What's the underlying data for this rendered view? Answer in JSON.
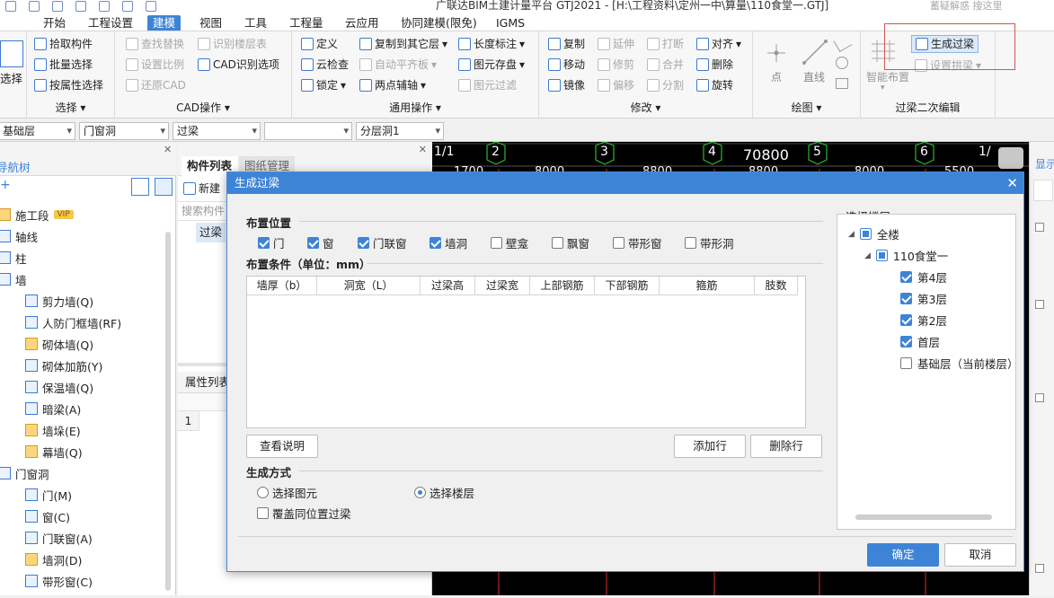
{
  "titlebar": {
    "title": "广联达BIM土建计量平台 GTJ2021 - [H:\\工程资料\\定州一中\\算量\\110食堂一.GTJ]",
    "search": "蓄疑解惑  搜这里"
  },
  "menu": [
    "开始",
    "工程设置",
    "建模",
    "视图",
    "工具",
    "工程量",
    "云应用",
    "协同建模(限免)",
    "IGMS"
  ],
  "ribbon": {
    "select": {
      "big": "选择",
      "label": "选择"
    },
    "pick": {
      "pick": "拾取构件",
      "batch": "批量选择",
      "byattr": "按属性选择"
    },
    "cad": {
      "find_replace": "查找替换",
      "set_scale": "设置比例",
      "restore_cad": "还原CAD",
      "identify_floor": "识别楼层表",
      "cad_options": "CAD识别选项",
      "label": "CAD操作"
    },
    "general": {
      "define": "定义",
      "cloud_check": "云检查",
      "lock": "锁定",
      "copy_other": "复制到其它层",
      "auto_flat": "自动平齐板",
      "two_point_axis": "两点辅轴",
      "length_mark": "长度标注",
      "elem_save": "图元存盘",
      "elem_filter": "图元过滤",
      "label": "通用操作"
    },
    "modify": {
      "copy": "复制",
      "move": "移动",
      "mirror": "镜像",
      "extend": "延伸",
      "trim": "修剪",
      "offset": "偏移",
      "break": "打断",
      "merge": "合并",
      "split": "分割",
      "align": "对齐",
      "delete": "删除",
      "rotate": "旋转",
      "label": "修改"
    },
    "draw": {
      "point": "点",
      "line": "直线",
      "label": "绘图"
    },
    "lintel": {
      "smart_layout": "智能布置",
      "gen_lintel": "生成过梁",
      "set_arch": "设置拱梁",
      "label": "过梁二次编辑"
    }
  },
  "filters": {
    "floor": "基础层",
    "category": "门窗洞",
    "type": "过梁",
    "blank": "",
    "layer": "分层洞1"
  },
  "nav": {
    "title": "导航树",
    "items": [
      {
        "label": "施工段",
        "badge": "VIP"
      },
      {
        "label": "轴线"
      },
      {
        "label": "柱"
      },
      {
        "label": "墙"
      },
      {
        "label": "剪力墙(Q)"
      },
      {
        "label": "人防门框墙(RF)"
      },
      {
        "label": "砌体墙(Q)"
      },
      {
        "label": "砌体加筋(Y)"
      },
      {
        "label": "保温墙(Q)"
      },
      {
        "label": "暗梁(A)"
      },
      {
        "label": "墙垛(E)"
      },
      {
        "label": "幕墙(Q)"
      },
      {
        "label": "门窗洞"
      },
      {
        "label": "门(M)"
      },
      {
        "label": "窗(C)"
      },
      {
        "label": "门联窗(A)"
      },
      {
        "label": "墙洞(D)"
      },
      {
        "label": "带形窗(C)"
      }
    ]
  },
  "complist": {
    "tab1": "构件列表",
    "tab2": "图纸管理",
    "new": "新建",
    "search": "搜索构件",
    "item": "过梁",
    "props": "属性列表",
    "row1": "1"
  },
  "canvas": {
    "axes": [
      "1/1",
      "2",
      "3",
      "4",
      "5",
      "6",
      "1/"
    ],
    "dim": "70800",
    "sub": [
      "1700",
      "8000",
      "8800",
      "8800",
      "8000",
      "5500"
    ]
  },
  "right": {
    "label": "显示"
  },
  "dialog": {
    "title": "生成过梁",
    "layout_pos": "布置位置",
    "positions": [
      {
        "label": "门",
        "checked": true
      },
      {
        "label": "窗",
        "checked": true
      },
      {
        "label": "门联窗",
        "checked": true
      },
      {
        "label": "墙洞",
        "checked": true
      },
      {
        "label": "壁龛",
        "checked": false
      },
      {
        "label": "飘窗",
        "checked": false
      },
      {
        "label": "带形窗",
        "checked": false
      },
      {
        "label": "带形洞",
        "checked": false
      }
    ],
    "conditions": "布置条件（单位：mm）",
    "columns": [
      "墙厚（b）",
      "洞宽（L）",
      "过梁高",
      "过梁宽",
      "上部钢筋",
      "下部钢筋",
      "箍筋",
      "肢数"
    ],
    "btn_help": "查看说明",
    "btn_add": "添加行",
    "btn_del": "删除行",
    "gen_mode": "生成方式",
    "mode_elem": "选择图元",
    "mode_floor": "选择楼层",
    "overwrite": "覆盖同位置过梁",
    "floor_title": "选择楼层",
    "floors": {
      "all": "全楼",
      "project": "110食堂一",
      "list": [
        {
          "label": "第4层",
          "checked": true
        },
        {
          "label": "第3层",
          "checked": true
        },
        {
          "label": "第2层",
          "checked": true
        },
        {
          "label": "首层",
          "checked": true
        },
        {
          "label": "基础层（当前楼层）",
          "checked": false
        }
      ]
    },
    "ok": "确定",
    "cancel": "取消"
  },
  "colors": {
    "accent": "#3d84d6",
    "highlight": "#d9534f"
  }
}
